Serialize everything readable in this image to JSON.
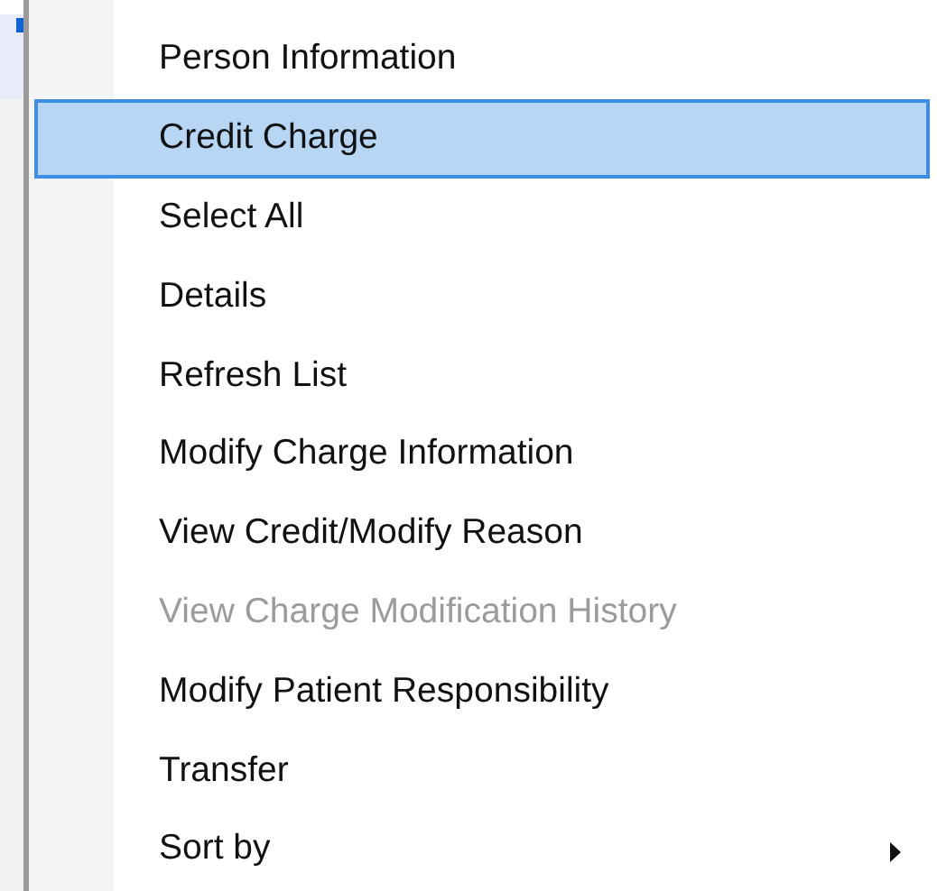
{
  "context_menu": {
    "items": [
      {
        "label": "Person Information",
        "selected": false,
        "disabled": false,
        "submenu": false
      },
      {
        "label": "Credit Charge",
        "selected": true,
        "disabled": false,
        "submenu": false
      },
      {
        "label": "Select All",
        "selected": false,
        "disabled": false,
        "submenu": false
      },
      {
        "label": "Details",
        "selected": false,
        "disabled": false,
        "submenu": false
      },
      {
        "label": "Refresh List",
        "selected": false,
        "disabled": false,
        "submenu": false
      },
      {
        "label": "Modify Charge Information",
        "selected": false,
        "disabled": false,
        "submenu": false
      },
      {
        "label": "View Credit/Modify Reason",
        "selected": false,
        "disabled": false,
        "submenu": false
      },
      {
        "label": "View Charge Modification History",
        "selected": false,
        "disabled": true,
        "submenu": false
      },
      {
        "label": "Modify Patient Responsibility",
        "selected": false,
        "disabled": false,
        "submenu": false
      },
      {
        "label": "Transfer",
        "selected": false,
        "disabled": false,
        "submenu": false
      },
      {
        "label": "Sort by",
        "selected": false,
        "disabled": false,
        "submenu": true
      }
    ]
  }
}
